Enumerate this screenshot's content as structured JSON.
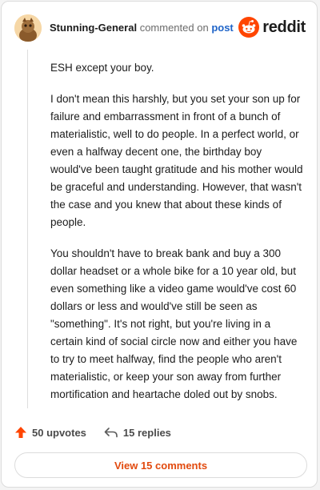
{
  "header": {
    "username": "Stunning-General",
    "action_text": "commented on",
    "post_link": "post",
    "brand": "reddit",
    "avatar_icon": "avatar-icon",
    "brand_icon": "reddit-logo-icon"
  },
  "comment": {
    "paragraphs": [
      "ESH except your boy.",
      "I don't mean this harshly, but you set your son up for failure and embarrassment in front of a bunch of materialistic, well to do people. In a perfect world, or even a halfway decent one, the birthday boy would've been taught gratitude and his mother would be graceful and understanding. However, that wasn't the case and you knew that about these kinds of people.",
      "You shouldn't have to break bank and buy a 300 dollar headset or a whole bike for a 10 year old, but even something like a video game would've cost 60 dollars or less and would've still be seen as \"something\". It's not right, but you're living in a certain kind of social circle now and either you have to try to meet halfway, find the people who aren't materialistic, or keep your son away from further mortification and heartache doled out by snobs."
    ]
  },
  "actions": {
    "upvotes": "50 upvotes",
    "replies": "15 replies",
    "upvote_icon": "upvote-arrow-icon",
    "reply_icon": "reply-arrow-icon"
  },
  "footer": {
    "view_comments": "View 15 comments"
  },
  "colors": {
    "accent": "#ff4500",
    "link": "#1f64c8",
    "view_button_text": "#e24a0e"
  }
}
